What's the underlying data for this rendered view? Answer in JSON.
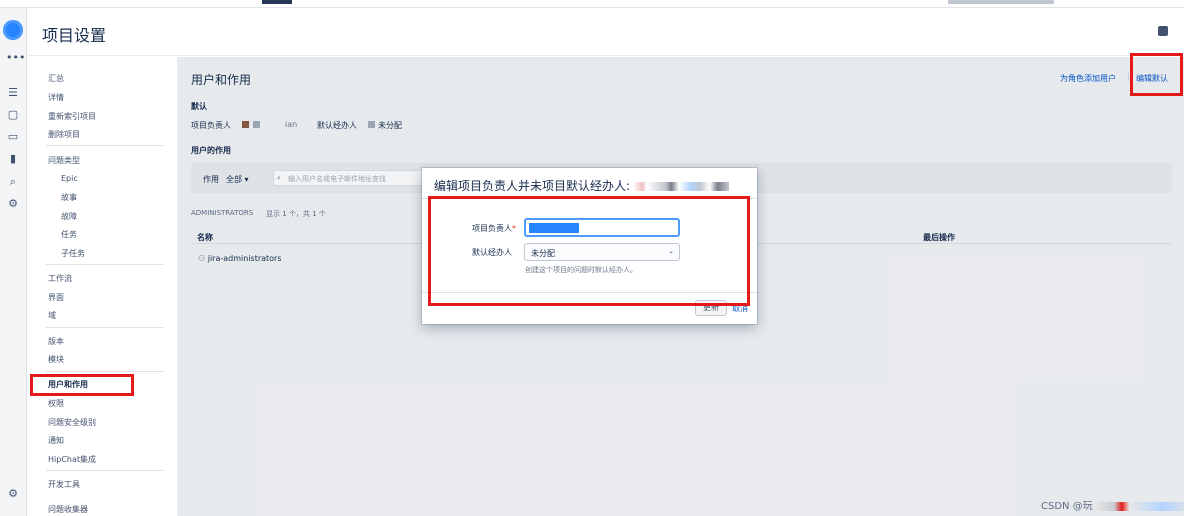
{
  "header": {
    "title": "项目设置"
  },
  "sidebar": {
    "g1": [
      "汇总",
      "详情",
      "重新索引项目",
      "删除项目"
    ],
    "issue_types": "问题类型",
    "issue_sub": [
      "Epic",
      "故事",
      "故障",
      "任务",
      "子任务"
    ],
    "g3": [
      "工作流",
      "界面",
      "域"
    ],
    "g4": [
      "版本",
      "模块"
    ],
    "g5": [
      "用户和作用",
      "权限",
      "问题安全级别",
      "通知",
      "HipChat集成"
    ],
    "g6": [
      "开发工具",
      "问题收集器"
    ]
  },
  "main": {
    "title": "用户和作用",
    "add_user_link": "为角色添加用户",
    "edit_defaults_link": "编辑默认",
    "defaults_heading": "默认",
    "project_lead_label": "项目负责人",
    "project_lead_value": "ian",
    "default_assignee_label": "默认经办人",
    "default_assignee_value": "未分配",
    "roles_heading": "用户的作用",
    "filter_label": "作用",
    "filter_value": "全部",
    "search_placeholder": "输入用户名或电子邮件地址查找",
    "group_heading": "ADMINISTRATORS",
    "group_count": "显示 1 个，共 1 个",
    "col_name": "名称",
    "col_last": "最后操作",
    "row1_name": "jira-administrators"
  },
  "dialog": {
    "title": "编辑项目负责人并未项目默认经办人:",
    "lead_label": "项目负责人",
    "required_mark": "*",
    "assignee_label": "默认经办人",
    "assignee_value": "未分配",
    "assignee_hint": "创建这个项目的问题时默认经办人。",
    "update_button": "更新",
    "cancel_link": "取消"
  },
  "watermark": "CSDN @玩",
  "colors": {
    "accent": "#0052cc",
    "highlight": "#e3191a",
    "selection": "#2684ff"
  }
}
